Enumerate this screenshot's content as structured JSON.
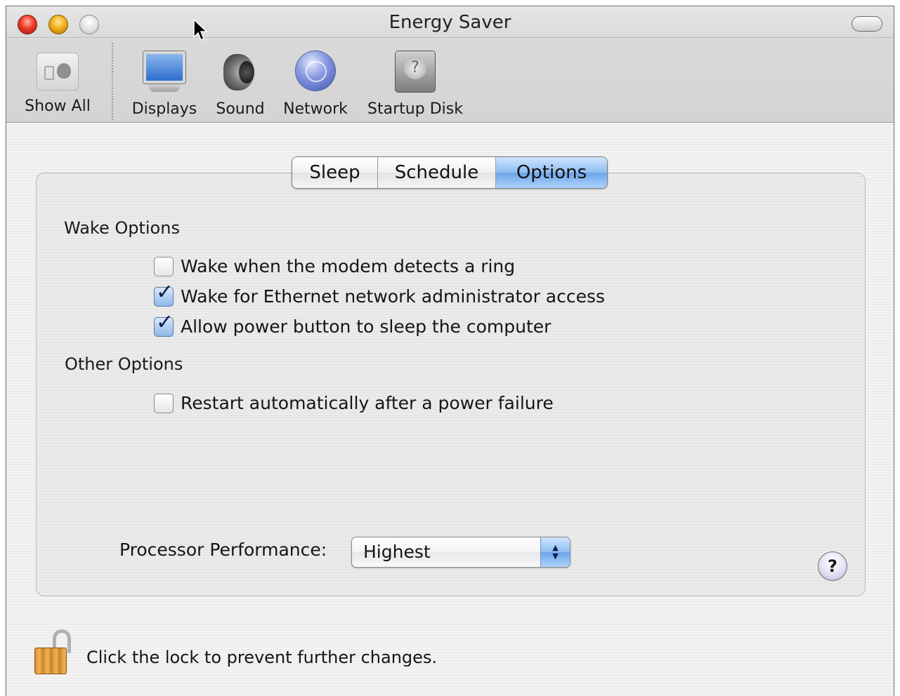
{
  "window": {
    "title": "Energy Saver"
  },
  "toolbar": {
    "items": [
      {
        "label": "Show All",
        "icon": "apple-grid-icon"
      },
      {
        "label": "Displays",
        "icon": "display-icon"
      },
      {
        "label": "Sound",
        "icon": "speaker-icon"
      },
      {
        "label": "Network",
        "icon": "globe-icon"
      },
      {
        "label": "Startup Disk",
        "icon": "hard-disk-icon"
      }
    ]
  },
  "tabs": [
    {
      "label": "Sleep",
      "active": false
    },
    {
      "label": "Schedule",
      "active": false
    },
    {
      "label": "Options",
      "active": true
    }
  ],
  "wake_options": {
    "title": "Wake Options",
    "items": [
      {
        "label": "Wake when the modem detects a ring",
        "checked": false
      },
      {
        "label": "Wake for Ethernet network administrator access",
        "checked": true
      },
      {
        "label": "Allow power button to sleep the computer",
        "checked": true
      }
    ]
  },
  "other_options": {
    "title": "Other Options",
    "items": [
      {
        "label": "Restart automatically after a power failure",
        "checked": false
      }
    ]
  },
  "processor": {
    "label": "Processor Performance:",
    "value": "Highest"
  },
  "help": {
    "glyph": "?"
  },
  "lock": {
    "text": "Click the lock to prevent further changes.",
    "state": "unlocked"
  },
  "colors": {
    "accent": "#6ca5ea"
  }
}
